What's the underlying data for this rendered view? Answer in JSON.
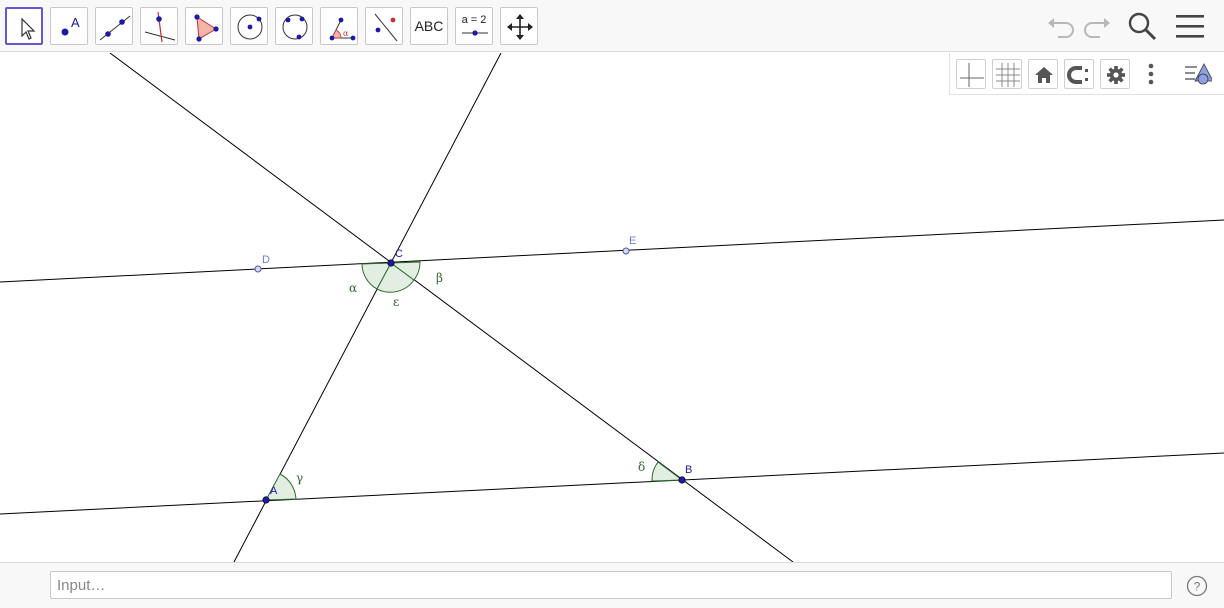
{
  "toolbar": {
    "tools": [
      {
        "name": "move-tool",
        "icon": "arrow-cursor-icon",
        "selected": true
      },
      {
        "name": "point-tool",
        "icon": "point-icon",
        "text": "A"
      },
      {
        "name": "line-tool",
        "icon": "line-icon"
      },
      {
        "name": "perpendicular-line-tool",
        "icon": "perpendicular-line-icon"
      },
      {
        "name": "polygon-tool",
        "icon": "polygon-icon"
      },
      {
        "name": "circle-center-point-tool",
        "icon": "circle-icon"
      },
      {
        "name": "circle-three-points-tool",
        "icon": "circle-three-points-icon"
      },
      {
        "name": "angle-tool",
        "icon": "angle-icon"
      },
      {
        "name": "reflect-about-line-tool",
        "icon": "reflect-line-icon"
      },
      {
        "name": "text-tool",
        "icon": "text-icon",
        "text": "ABC"
      },
      {
        "name": "slider-tool",
        "icon": "slider-icon",
        "text": "a = 2"
      },
      {
        "name": "move-graphics-view-tool",
        "icon": "move-arrows-icon"
      }
    ],
    "right": [
      "undo-icon",
      "redo-icon",
      "search-icon",
      "menu-icon"
    ]
  },
  "graphics_bar": [
    "axes-icon",
    "grid-icon",
    "home-icon",
    "point-capturing-icon",
    "gear-icon",
    "more-vertical-icon",
    "style-bar-icon"
  ],
  "construction": {
    "points": [
      {
        "label": "A",
        "kind": "free"
      },
      {
        "label": "B",
        "kind": "free"
      },
      {
        "label": "C",
        "kind": "free"
      },
      {
        "label": "D",
        "kind": "dependent"
      },
      {
        "label": "E",
        "kind": "dependent"
      }
    ],
    "angles": [
      "α",
      "β",
      "ε",
      "γ",
      "δ"
    ]
  },
  "colors": {
    "free_point": "#1a1aa6",
    "dependent_point": "#6f7fcf",
    "angle_fill": "#e2eee2",
    "angle_stroke": "#2e6b2e",
    "selected_tool": "#6557d2"
  },
  "input_bar": {
    "placeholder": "Input…"
  }
}
